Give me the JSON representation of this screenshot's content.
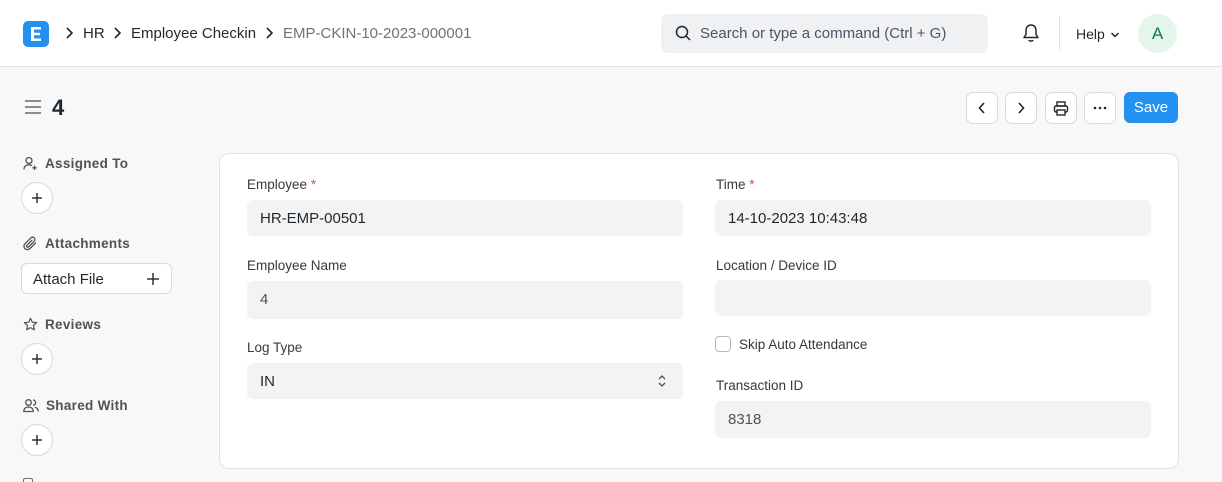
{
  "navbar": {
    "logo_letter": "E",
    "breadcrumbs": [
      "HR",
      "Employee Checkin",
      "EMP-CKIN-10-2023-000001"
    ],
    "search_placeholder": "Search or type a command (Ctrl + G)",
    "help_label": "Help",
    "avatar_initial": "A"
  },
  "page": {
    "title": "4",
    "save_label": "Save"
  },
  "sidebar": {
    "assigned_to": "Assigned To",
    "attachments": "Attachments",
    "attach_file": "Attach File",
    "reviews": "Reviews",
    "shared_with": "Shared With"
  },
  "form": {
    "employee": {
      "label": "Employee",
      "value": "HR-EMP-00501",
      "required": true
    },
    "employee_name": {
      "label": "Employee Name",
      "value": "4"
    },
    "log_type": {
      "label": "Log Type",
      "value": "IN"
    },
    "time": {
      "label": "Time",
      "value": "14-10-2023 10:43:48",
      "required": true
    },
    "location": {
      "label": "Location / Device ID",
      "value": ""
    },
    "skip_auto_attendance": {
      "label": "Skip Auto Attendance",
      "checked": false
    },
    "transaction_id": {
      "label": "Transaction ID",
      "value": "8318"
    }
  },
  "colors": {
    "primary": "#2490ef",
    "required": "#e24c4c",
    "avatar_bg": "#e4f5e9",
    "avatar_fg": "#16794c"
  }
}
